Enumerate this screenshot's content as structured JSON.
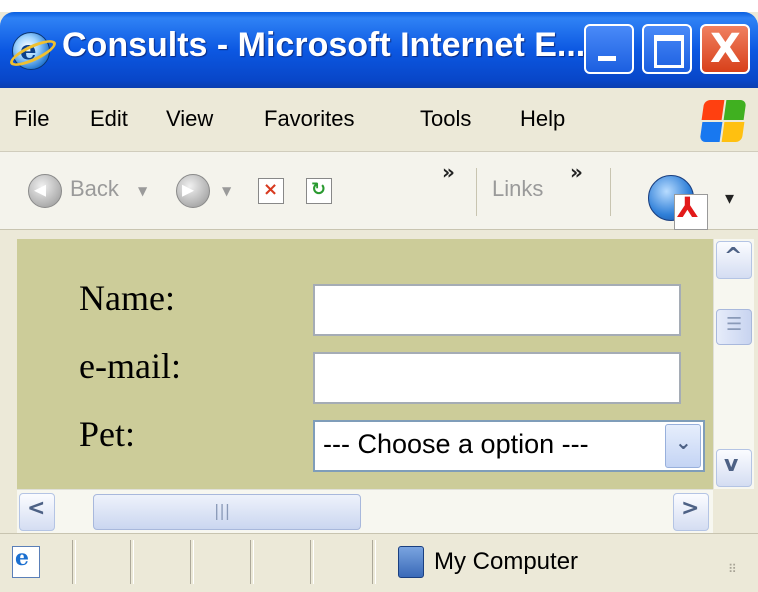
{
  "window": {
    "title": "Consults - Microsoft Internet E...",
    "controls": {
      "minimize": "_",
      "maximize": "□",
      "close": "X"
    },
    "app_icon": "ie-icon"
  },
  "menubar": {
    "items": [
      "File",
      "Edit",
      "View",
      "Favorites",
      "Tools",
      "Help"
    ],
    "brand_icon": "windows-flag-icon"
  },
  "toolbar": {
    "back_label": "Back",
    "back_icon": "back-arrow-icon",
    "forward_icon": "forward-arrow-icon",
    "stop_icon": "stop-icon",
    "refresh_icon": "refresh-icon",
    "overflow_chevron": "»",
    "links_label": "Links",
    "links_chevron": "»",
    "extension_icon": "pdf-globe-icon",
    "extension_dropdown": "▾"
  },
  "form": {
    "name_label": "Name:",
    "name_value": "",
    "email_label": "e-mail:",
    "email_value": "",
    "pet_label": "Pet:",
    "pet_selected": "--- Choose a option ---"
  },
  "colors": {
    "page_background": "#cccc99",
    "titlebar_blue": "#0c58e2",
    "close_red": "#d8401a",
    "chrome": "#ece9d8"
  },
  "scrollbars": {
    "up": "^",
    "down": "v",
    "left": "<",
    "right": ">",
    "grip": "|||"
  },
  "statusbar": {
    "zone_label": "My Computer",
    "zone_icon": "my-computer-icon",
    "page_icon": "ie-page-icon"
  }
}
